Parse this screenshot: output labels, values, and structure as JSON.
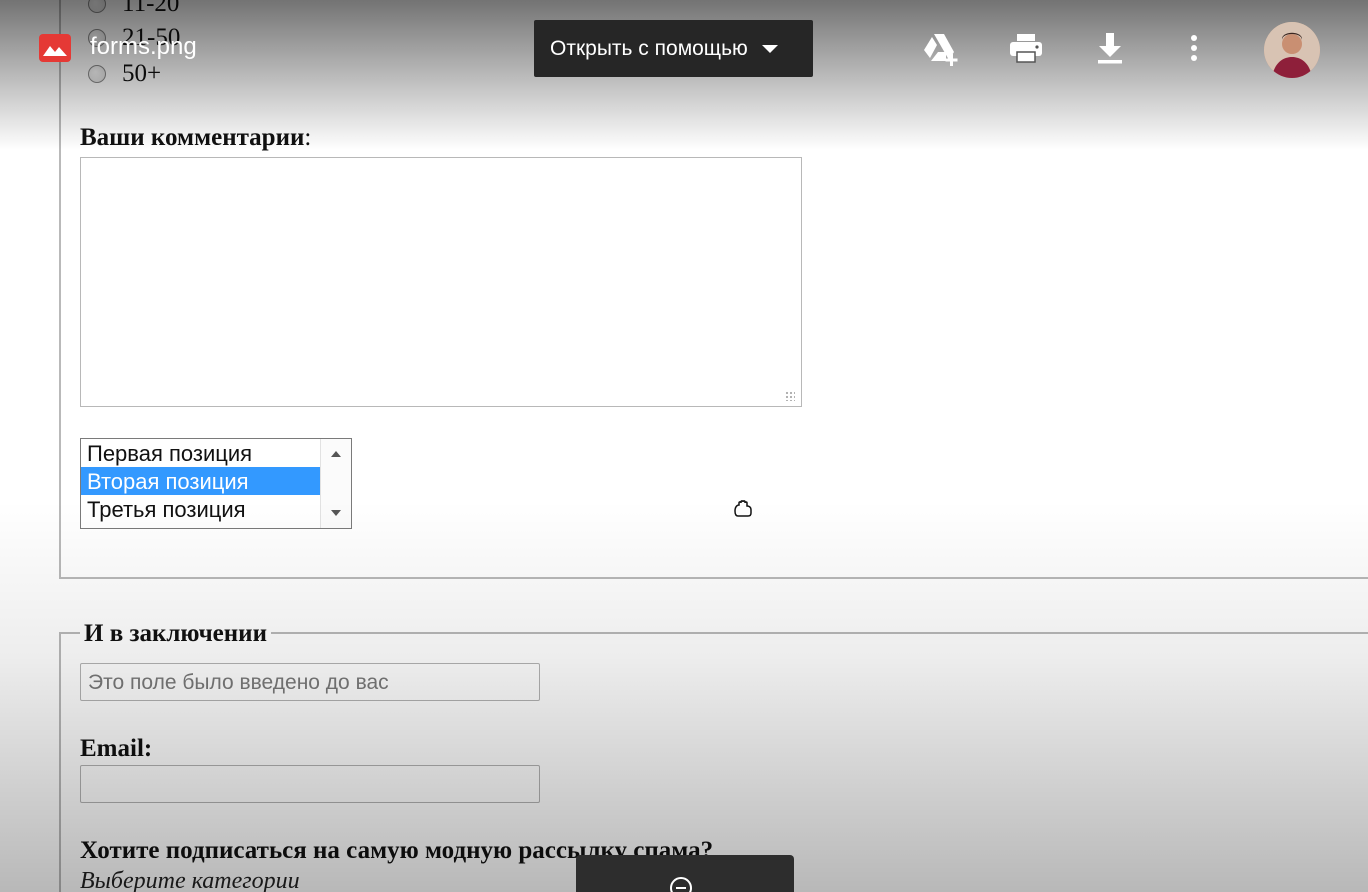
{
  "viewer": {
    "filename": "forms.png",
    "open_with_label": "Открыть с помощью",
    "toolbar_icons": [
      "add-to-drive-icon",
      "print-icon",
      "download-icon",
      "more-vert-icon"
    ],
    "accent_color": "#e53935"
  },
  "form": {
    "radio_options": [
      "11-20",
      "21-50",
      "50+"
    ],
    "comments_label": "Ваши комментарии",
    "comments_colon": ":",
    "comments_value": "",
    "listbox_options": [
      "Первая позиция",
      "Вторая позиция",
      "Третья позиция"
    ],
    "listbox_selected": "Вторая позиция",
    "section_legend": "И в заключении",
    "prefilled_placeholder": "Это поле было введено до вас",
    "email_label": "Email:",
    "email_value": "",
    "subscribe_question": "Хотите подписаться на самую модную рассылку спама?",
    "subscribe_hint": "Выберите категории",
    "selection_color": "#3399ff"
  }
}
